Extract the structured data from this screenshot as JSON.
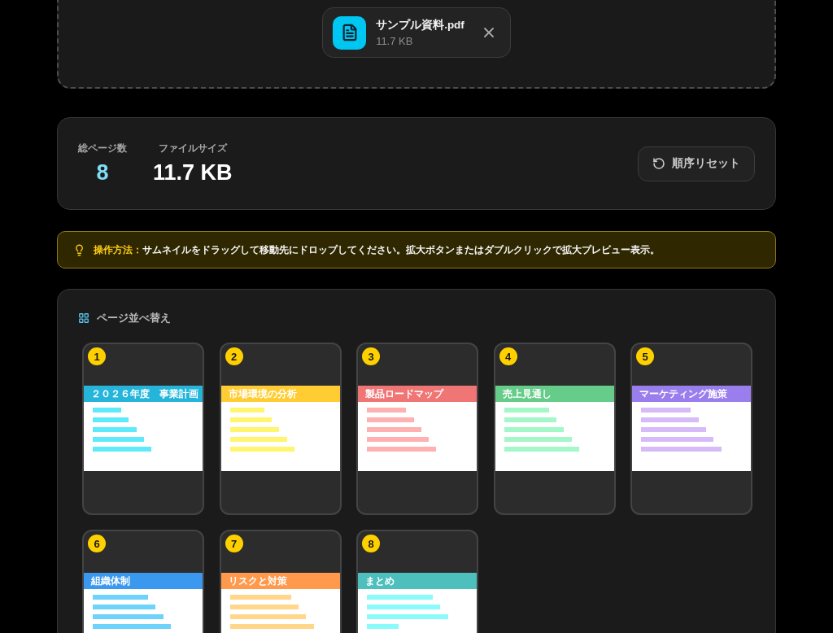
{
  "upload": {
    "file": {
      "name": "サンプル資料.pdf",
      "size": "11.7 KB"
    }
  },
  "stats": {
    "items": [
      {
        "label": "総ページ数",
        "value": "8",
        "kind": "count"
      },
      {
        "label": "ファイルサイズ",
        "value": "11.7 KB",
        "kind": "size"
      }
    ],
    "reset_button": "順序リセット"
  },
  "hint": {
    "text": "**操作方法：**サムネイルをドラッグして移動先にドロップしてください。拡大ボタンまたはダブルクリックで拡大プレビュー表示。"
  },
  "reorder": {
    "title": "ページ並べ替え",
    "pages": [
      {
        "number": "1",
        "header": {
          "title": "２０２６年度　事業計画",
          "color": "#25b5da"
        },
        "bars": {
          "color": "#5eeafa"
        }
      },
      {
        "number": "2",
        "header": {
          "title": "市場環境の分析",
          "color": "#ffcc33"
        },
        "bars": {
          "color": "#fff56e"
        }
      },
      {
        "number": "3",
        "header": {
          "title": "製品ロードマップ",
          "color": "#f07575"
        },
        "bars": {
          "color": "#ffb0b0"
        }
      },
      {
        "number": "4",
        "header": {
          "title": "売上見通し",
          "color": "#66cc8a"
        },
        "bars": {
          "color": "#a3f7c8"
        }
      },
      {
        "number": "5",
        "header": {
          "title": "マーケティング施策",
          "color": "#9a7eed"
        },
        "bars": {
          "color": "#d6bbf8"
        }
      },
      {
        "number": "6",
        "header": {
          "title": "組織体制",
          "color": "#3a99ee"
        },
        "bars": {
          "color": "#6dd3fa"
        }
      },
      {
        "number": "7",
        "header": {
          "title": "リスクと対策",
          "color": "#ff9a4d"
        },
        "bars": {
          "color": "#ffd68a"
        }
      },
      {
        "number": "8",
        "header": {
          "title": "まとめ",
          "color": "#4dbfbd"
        },
        "bars": {
          "color": "#8afafa"
        }
      }
    ]
  }
}
